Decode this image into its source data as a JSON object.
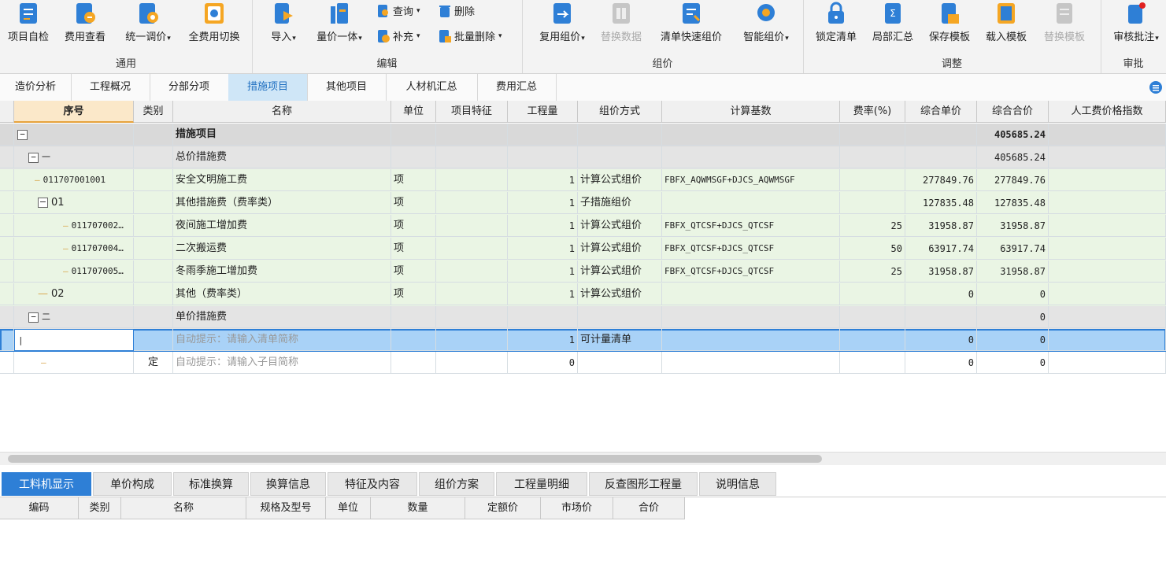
{
  "ribbon": {
    "groups": [
      "通用",
      "编辑",
      "组价",
      "调整",
      "审批"
    ],
    "general": [
      "项目自检",
      "费用查看",
      "统一调价",
      "全费用切换"
    ],
    "edit": {
      "import": "导入",
      "qty_price": "量价一体",
      "query": "查询",
      "delete": "删除",
      "supplement": "补充",
      "batch_delete": "批量删除"
    },
    "pricing": [
      "复用组价",
      "替换数据",
      "清单快速组价",
      "智能组价"
    ],
    "adjust": [
      "锁定清单",
      "局部汇总",
      "保存模板",
      "载入模板",
      "替换模板"
    ],
    "approve": [
      "审核批注"
    ]
  },
  "tabs": [
    "造价分析",
    "工程概况",
    "分部分项",
    "措施项目",
    "其他项目",
    "人材机汇总",
    "费用汇总"
  ],
  "active_tab": "措施项目",
  "columns": [
    "序号",
    "类别",
    "名称",
    "单位",
    "项目特征",
    "工程量",
    "组价方式",
    "计算基数",
    "费率(%)",
    "综合单价",
    "综合合价",
    "人工费价格指数"
  ],
  "rows": [
    {
      "n": "",
      "seq": "",
      "cat": "",
      "name": "措施项目",
      "unit": "",
      "qty": "",
      "method": "",
      "base": "",
      "rate": "",
      "uprice": "",
      "total": "405685.24"
    },
    {
      "n": "",
      "seq": "一",
      "cat": "",
      "name": "总价措施费",
      "unit": "",
      "qty": "",
      "method": "",
      "base": "",
      "rate": "",
      "uprice": "",
      "total": "405685.24"
    },
    {
      "n": "1",
      "seq": "011707001001",
      "cat": "",
      "name": "安全文明施工费",
      "unit": "项",
      "qty": "1",
      "method": "计算公式组价",
      "base": "FBFX_AQWMSGF+DJCS_AQWMSGF",
      "rate": "",
      "uprice": "277849.76",
      "total": "277849.76"
    },
    {
      "n": "2",
      "seq": "01",
      "cat": "",
      "name": "其他措施费（费率类）",
      "unit": "项",
      "qty": "1",
      "method": "子措施组价",
      "base": "",
      "rate": "",
      "uprice": "127835.48",
      "total": "127835.48"
    },
    {
      "n": "3",
      "seq": "011707002…",
      "cat": "",
      "name": "夜间施工增加费",
      "unit": "项",
      "qty": "1",
      "method": "计算公式组价",
      "base": "FBFX_QTCSF+DJCS_QTCSF",
      "rate": "25",
      "uprice": "31958.87",
      "total": "31958.87"
    },
    {
      "n": "4",
      "seq": "011707004…",
      "cat": "",
      "name": "二次搬运费",
      "unit": "项",
      "qty": "1",
      "method": "计算公式组价",
      "base": "FBFX_QTCSF+DJCS_QTCSF",
      "rate": "50",
      "uprice": "63917.74",
      "total": "63917.74"
    },
    {
      "n": "5",
      "seq": "011707005…",
      "cat": "",
      "name": "冬雨季施工增加费",
      "unit": "项",
      "qty": "1",
      "method": "计算公式组价",
      "base": "FBFX_QTCSF+DJCS_QTCSF",
      "rate": "25",
      "uprice": "31958.87",
      "total": "31958.87"
    },
    {
      "n": "6",
      "seq": "02",
      "cat": "",
      "name": "其他（费率类）",
      "unit": "项",
      "qty": "1",
      "method": "计算公式组价",
      "base": "",
      "rate": "",
      "uprice": "0",
      "total": "0"
    },
    {
      "n": "",
      "seq": "二",
      "cat": "",
      "name": "单价措施费",
      "unit": "",
      "qty": "",
      "method": "",
      "base": "",
      "rate": "",
      "uprice": "",
      "total": "0"
    },
    {
      "n": "7",
      "seq": "",
      "cat": "",
      "name": "自动提示：请输入清单简称",
      "unit": "",
      "qty": "1",
      "method": "可计量清单",
      "base": "",
      "rate": "",
      "uprice": "0",
      "total": "0"
    },
    {
      "n": "",
      "seq": "",
      "cat": "定",
      "name": "自动提示：请输入子目简称",
      "unit": "",
      "qty": "0",
      "method": "",
      "base": "",
      "rate": "",
      "uprice": "0",
      "total": "0"
    }
  ],
  "bottom_tabs": [
    "工料机显示",
    "单价构成",
    "标准换算",
    "换算信息",
    "特征及内容",
    "组价方案",
    "工程量明细",
    "反查图形工程量",
    "说明信息"
  ],
  "bottom_columns": [
    "编码",
    "类别",
    "名称",
    "规格及型号",
    "单位",
    "数量",
    "定额价",
    "市场价",
    "合价"
  ],
  "colors": {
    "accent": "#2e7fd6",
    "selected_row": "#a9d2f7",
    "green_row": "#eaf5e4",
    "group_row": "#d9d9d9"
  }
}
